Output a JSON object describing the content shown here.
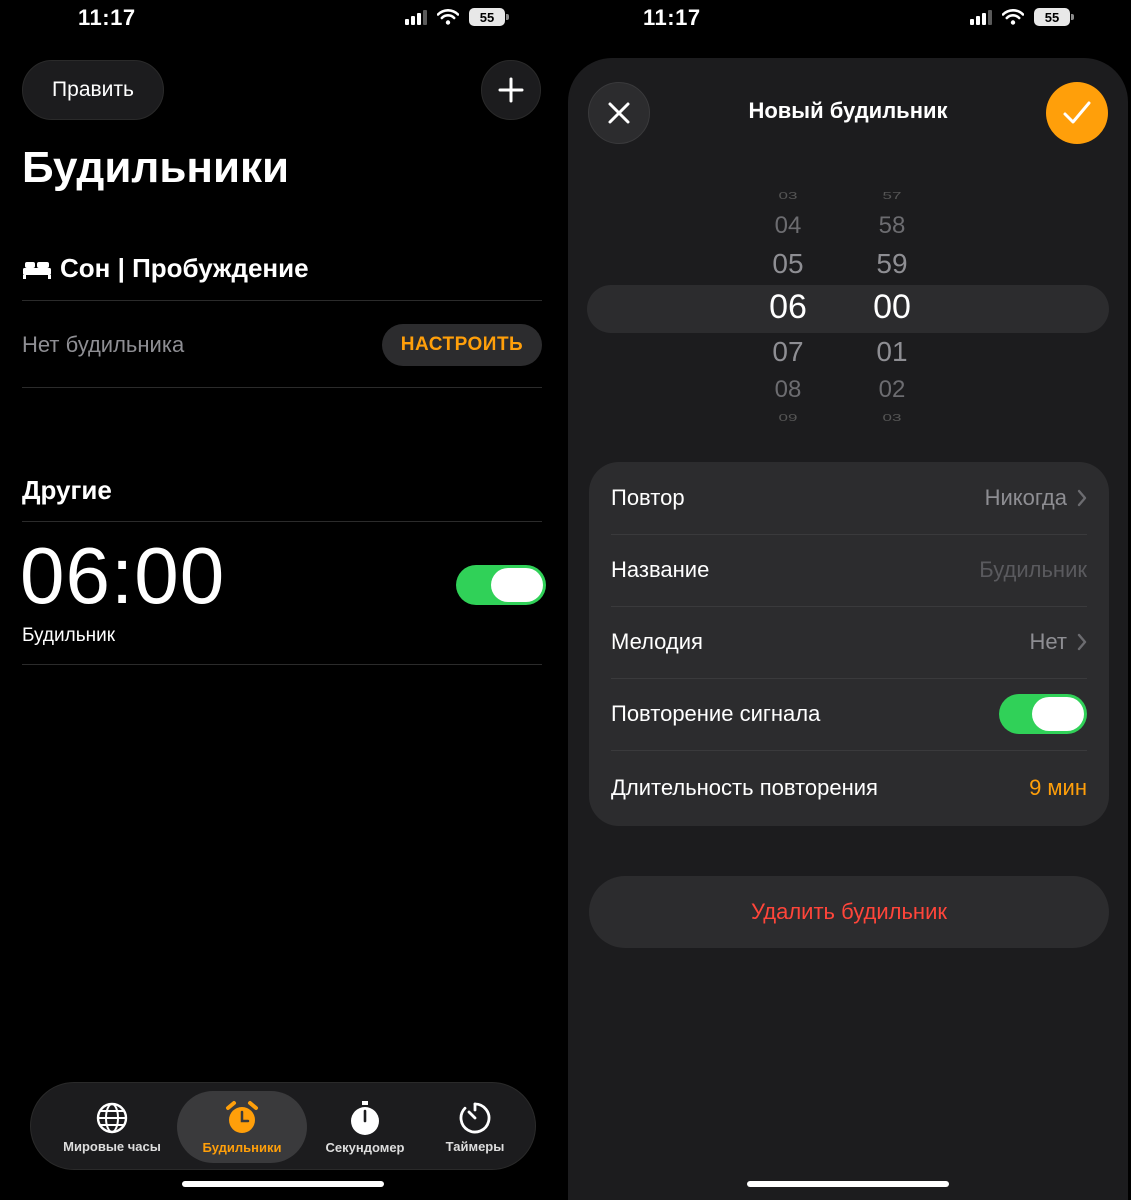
{
  "left": {
    "status": {
      "time": "11:17",
      "battery": "55"
    },
    "header": {
      "edit_label": "Править",
      "add_icon": "plus-icon"
    },
    "title": "Будильники",
    "sleep": {
      "icon": "bed-icon",
      "heading": "Сон | Пробуждение",
      "no_alarm": "Нет будильника",
      "setup_label": "НАСТРОИТЬ"
    },
    "other": {
      "heading": "Другие",
      "alarms": [
        {
          "time": "06:00",
          "label": "Будильник",
          "enabled": true
        }
      ]
    },
    "tabs": [
      {
        "label": "Мировые часы",
        "icon": "globe-icon",
        "active": false
      },
      {
        "label": "Будильники",
        "icon": "alarm-clock-icon",
        "active": true
      },
      {
        "label": "Секундомер",
        "icon": "stopwatch-icon",
        "active": false
      },
      {
        "label": "Таймеры",
        "icon": "timer-icon",
        "active": false
      }
    ]
  },
  "right": {
    "status": {
      "time": "11:17",
      "battery": "55"
    },
    "sheet": {
      "title": "Новый будильник",
      "close_icon": "close-icon",
      "confirm_icon": "checkmark-icon"
    },
    "picker": {
      "hours": [
        "03",
        "04",
        "05",
        "06",
        "07",
        "08",
        "09"
      ],
      "minutes": [
        "57",
        "58",
        "59",
        "00",
        "01",
        "02",
        "03"
      ],
      "selected_hour": "06",
      "selected_minute": "00"
    },
    "settings": [
      {
        "label": "Повтор",
        "value": "Никогда",
        "chevron": true
      },
      {
        "label": "Название",
        "placeholder": "Будильник"
      },
      {
        "label": "Мелодия",
        "value": "Нет",
        "chevron": true
      },
      {
        "label": "Повторение сигнала",
        "toggle": true
      },
      {
        "label": "Длительность повторения",
        "value": "9 мин"
      }
    ],
    "delete_label": "Удалить будильник"
  },
  "colors": {
    "accent": "#ff9f0a",
    "toggle_on": "#30d158",
    "destructive": "#ff453a"
  }
}
